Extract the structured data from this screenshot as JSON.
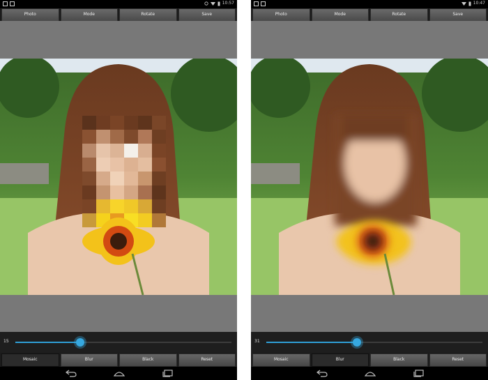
{
  "left": {
    "status": {
      "time": "10:57"
    },
    "toolbar": {
      "photo": "Photo",
      "mode": "Mode",
      "rotate": "Rotate",
      "save": "Save"
    },
    "slider": {
      "value_text": "15",
      "fraction": 0.3
    },
    "modes": {
      "mosaic": "Mosaic",
      "blur": "Blur",
      "black": "Black",
      "reset": "Reset",
      "active": "Mosaic"
    }
  },
  "right": {
    "status": {
      "time": "10:47"
    },
    "toolbar": {
      "photo": "Photo",
      "mode": "Mode",
      "rotate": "Rotate",
      "save": "Save"
    },
    "slider": {
      "value_text": "31",
      "fraction": 0.42
    },
    "modes": {
      "mosaic": "Mosaic",
      "blur": "Blur",
      "black": "Black",
      "reset": "Reset",
      "active": "Blur"
    }
  },
  "colors": {
    "accent": "#2fa0d8",
    "panel": "#787878",
    "bar": "#1b1b1b"
  },
  "icons": {
    "status_left": [
      "notification-icon",
      "notification-icon"
    ],
    "status_right": [
      "alarm-icon",
      "wifi-icon",
      "battery-icon"
    ],
    "nav": [
      "back-icon",
      "home-icon",
      "recent-apps-icon"
    ]
  }
}
